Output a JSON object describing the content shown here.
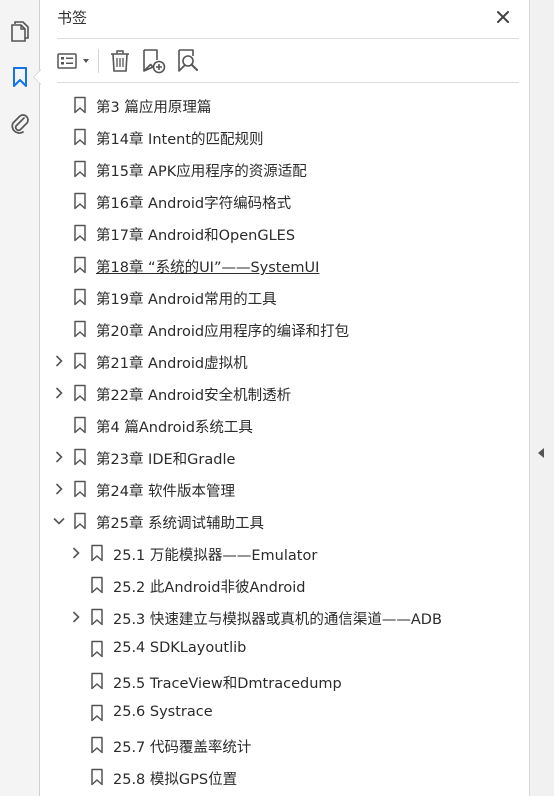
{
  "panel": {
    "title": "书签"
  },
  "toolbar": {
    "options_icon": "list-options-icon",
    "delete_icon": "trash-icon",
    "new_bookmark_icon": "bookmark-add-icon",
    "find_bookmark_icon": "bookmark-search-icon"
  },
  "rail": {
    "pages_icon": "pages-icon",
    "bookmarks_icon": "bookmark-icon",
    "attachments_icon": "paperclip-icon"
  },
  "colors": {
    "accent": "#1473e6",
    "icon": "#555555",
    "text": "#2b2b2b"
  },
  "bookmarks": [
    {
      "label": "第3 篇应用原理篇",
      "level": 0,
      "expander": "none"
    },
    {
      "label": "第14章 Intent的匹配规则",
      "level": 0,
      "expander": "none"
    },
    {
      "label": "第15章 APK应用程序的资源适配",
      "level": 0,
      "expander": "none"
    },
    {
      "label": "第16章 Android字符编码格式",
      "level": 0,
      "expander": "none"
    },
    {
      "label": "第17章 Android和OpenGLES",
      "level": 0,
      "expander": "none"
    },
    {
      "label": "第18章 “系统的UI”——SystemUI",
      "level": 0,
      "expander": "none",
      "underline": true
    },
    {
      "label": "第19章 Android常用的工具",
      "level": 0,
      "expander": "none"
    },
    {
      "label": "第20章 Android应用程序的编译和打包",
      "level": 0,
      "expander": "none"
    },
    {
      "label": "第21章 Android虚拟机",
      "level": 0,
      "expander": "collapsed"
    },
    {
      "label": "第22章 Android安全机制透析",
      "level": 0,
      "expander": "collapsed"
    },
    {
      "label": "第4 篇Android系统工具",
      "level": 0,
      "expander": "none"
    },
    {
      "label": "第23章 IDE和Gradle",
      "level": 0,
      "expander": "collapsed"
    },
    {
      "label": "第24章 软件版本管理",
      "level": 0,
      "expander": "collapsed"
    },
    {
      "label": "第25章 系统调试辅助工具",
      "level": 0,
      "expander": "expanded"
    },
    {
      "label": "25.1 万能模拟器——Emulator",
      "level": 1,
      "expander": "collapsed"
    },
    {
      "label": "25.2 此Android非彼Android",
      "level": 1,
      "expander": "none"
    },
    {
      "label": "25.3 快速建立与模拟器或真机的通信渠道——ADB",
      "level": 1,
      "expander": "collapsed"
    },
    {
      "label": "25.4 SDKLayoutlib",
      "level": 1,
      "expander": "none"
    },
    {
      "label": "25.5 TraceView和Dmtracedump",
      "level": 1,
      "expander": "none"
    },
    {
      "label": "25.6 Systrace",
      "level": 1,
      "expander": "none"
    },
    {
      "label": "25.7 代码覆盖率统计",
      "level": 1,
      "expander": "none"
    },
    {
      "label": "25.8 模拟GPS位置",
      "level": 1,
      "expander": "none"
    }
  ]
}
